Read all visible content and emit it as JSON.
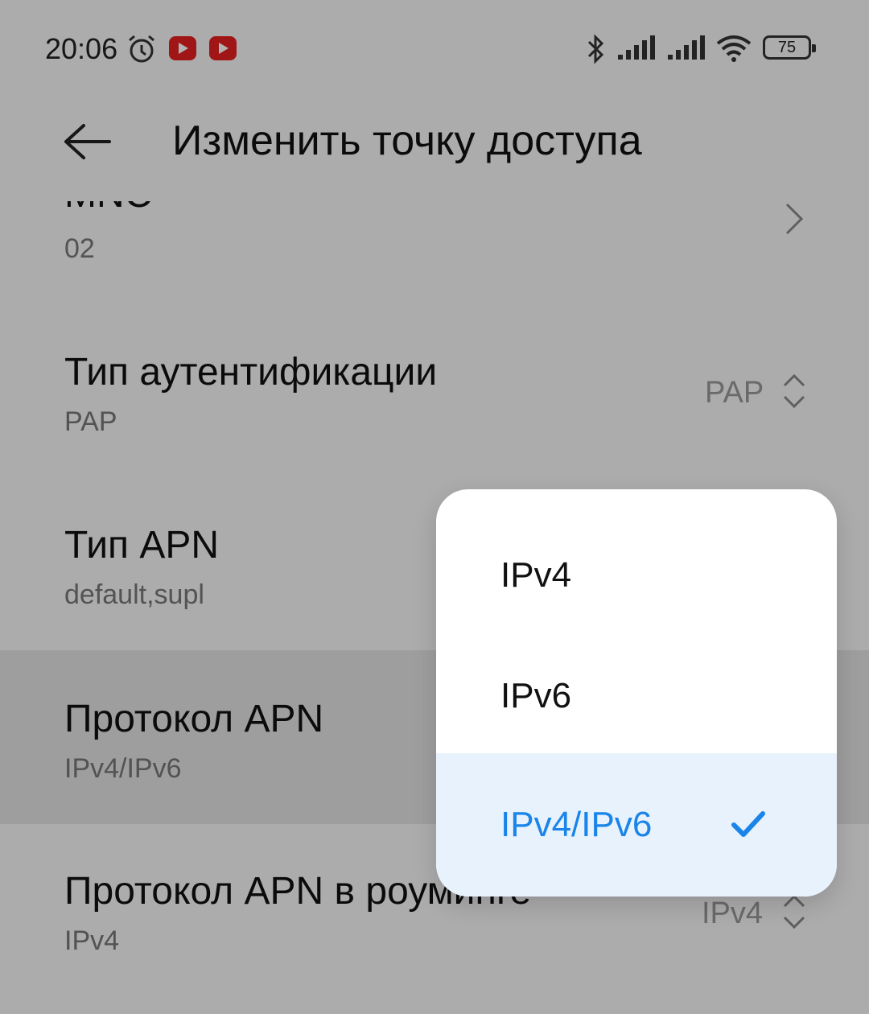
{
  "statusbar": {
    "time": "20:06",
    "battery": "75",
    "icons": [
      "alarm-icon",
      "youtube-icon",
      "youtube-icon",
      "bluetooth-icon",
      "signal-icon",
      "signal-icon",
      "wifi-icon",
      "battery-icon"
    ]
  },
  "header": {
    "title": "Изменить точку доступа",
    "back_icon": "arrow-left-icon"
  },
  "rows": [
    {
      "title": "MNC",
      "subtitle": "02",
      "control": "chevron-right"
    },
    {
      "title": "Тип аутентификации",
      "subtitle": "PAP",
      "value": "PAP",
      "control": "up-down"
    },
    {
      "title": "Тип APN",
      "subtitle": "default,supl"
    },
    {
      "title": "Протокол APN",
      "subtitle": "IPv4/IPv6"
    },
    {
      "title": "Протокол APN в роуминге",
      "subtitle": "IPv4",
      "value": "IPv4",
      "control": "up-down"
    }
  ],
  "popup": {
    "options": [
      "IPv4",
      "IPv6",
      "IPv4/IPv6"
    ],
    "selected": "IPv4/IPv6"
  },
  "colors": {
    "accent": "#1a85e8",
    "selected_bg": "#e8f2fd",
    "background": "#f7f7f7"
  }
}
